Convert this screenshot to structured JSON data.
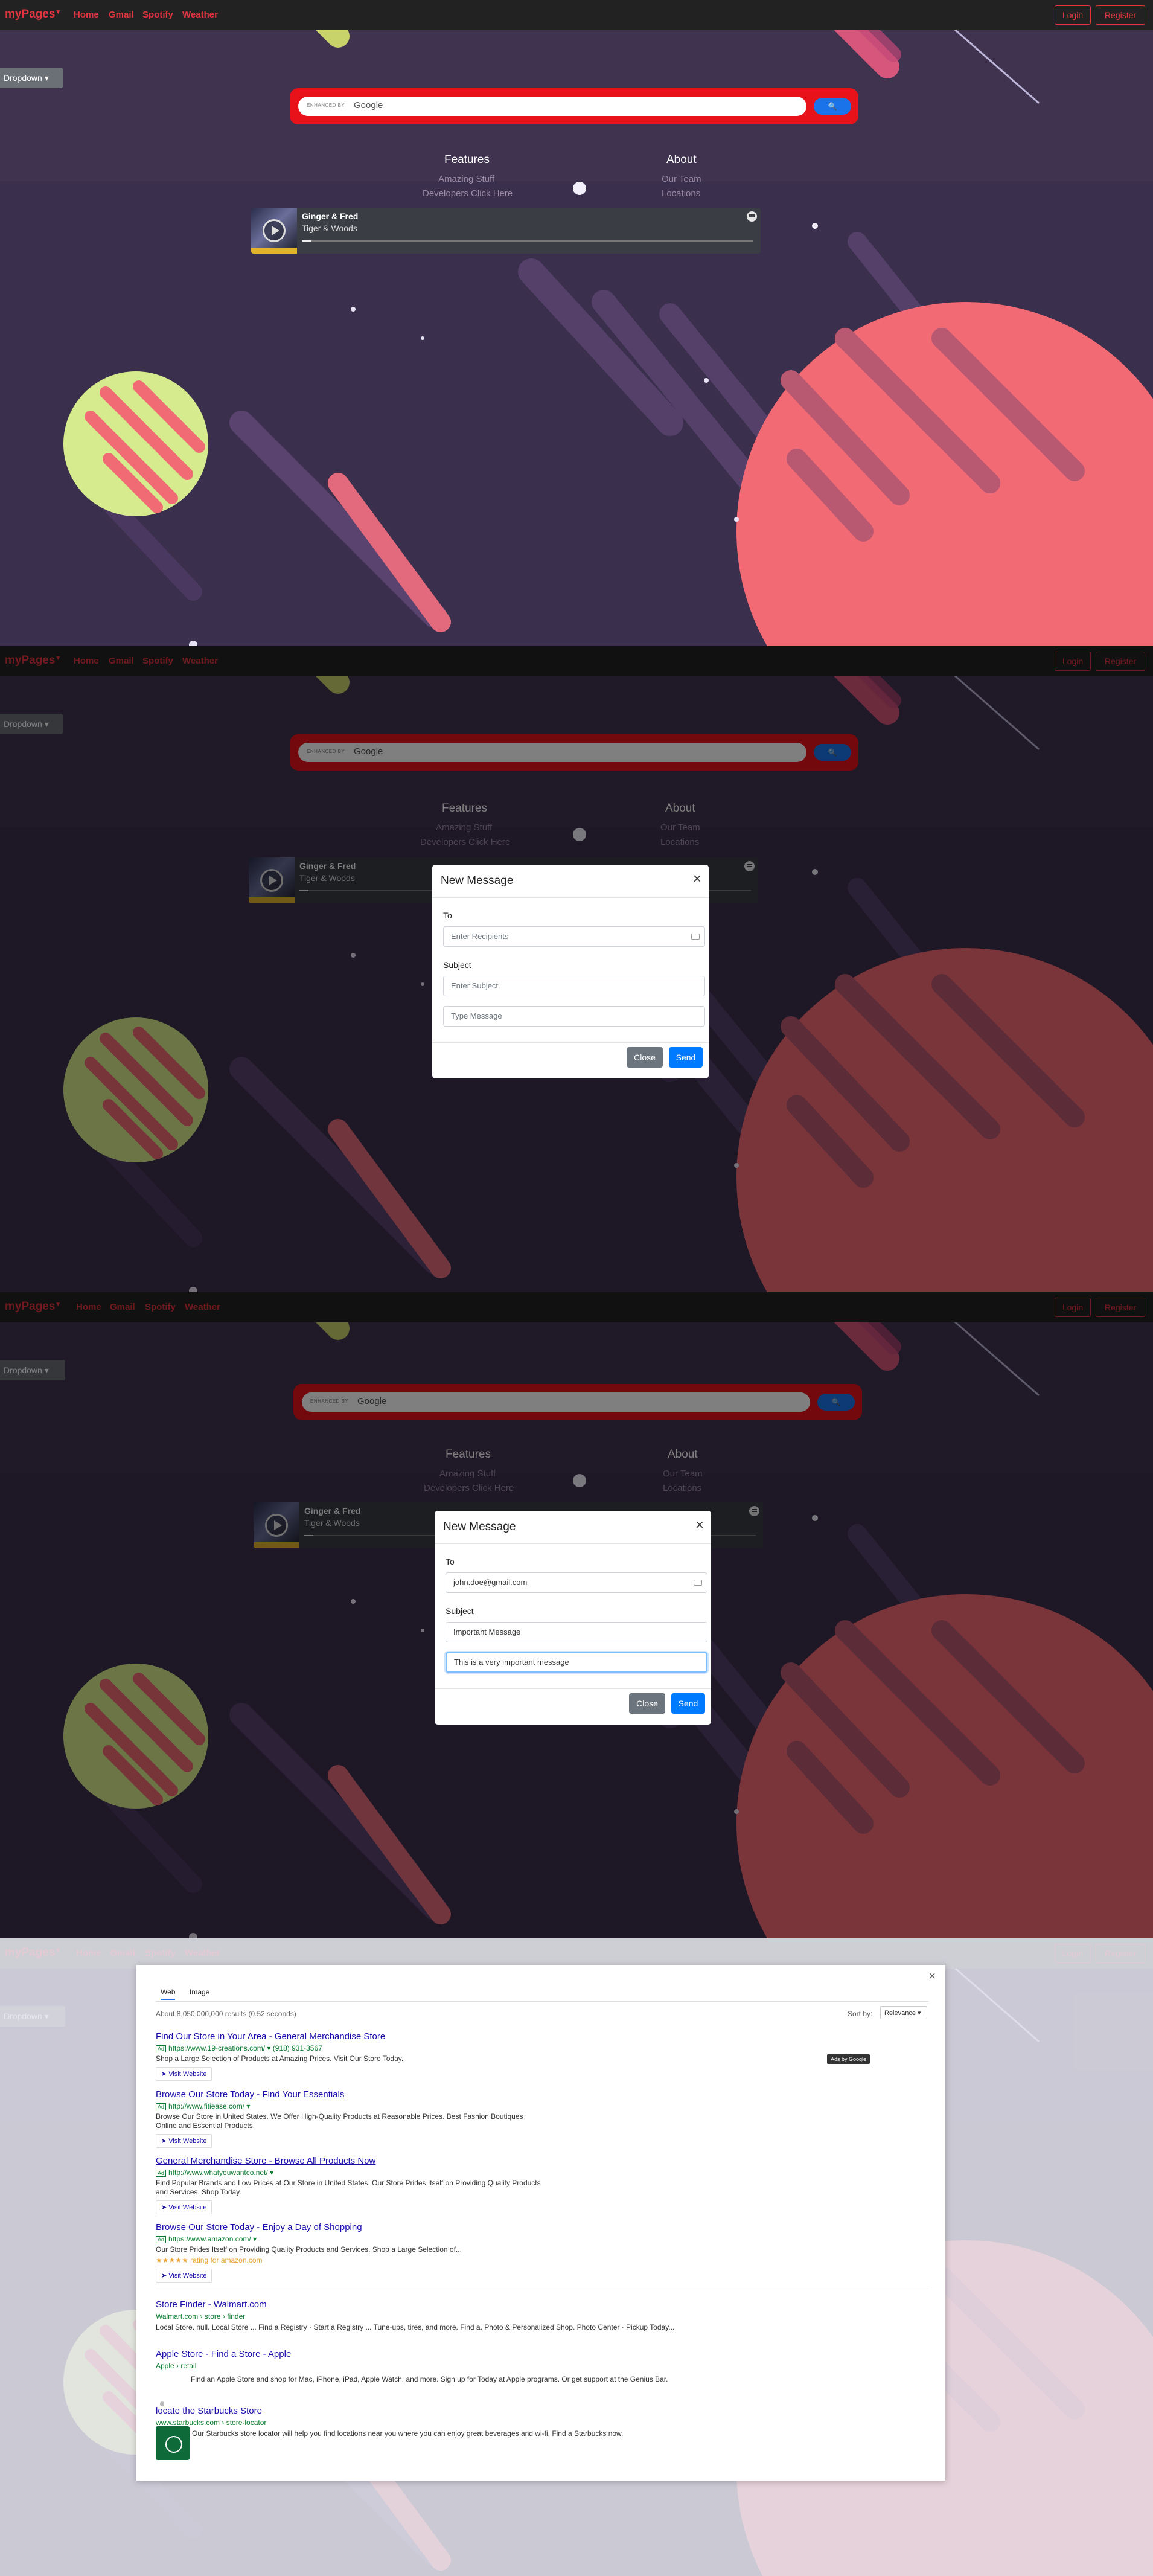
{
  "navbar": {
    "brand": "myPages",
    "brand_caret": "▾",
    "links": [
      "Home",
      "Gmail",
      "Spotify",
      "Weather"
    ],
    "login": "Login",
    "register": "Register"
  },
  "dropdown": {
    "label": "Dropdown ▾"
  },
  "search": {
    "enhanced_by": "ENHANCED BY",
    "google": "Google",
    "button_icon": "search-icon"
  },
  "features": {
    "title": "Features",
    "links": [
      "Amazing Stuff",
      "Developers Click Here"
    ]
  },
  "about": {
    "title": "About",
    "links": [
      "Our Team",
      "Locations"
    ]
  },
  "player": {
    "track": "Ginger & Fred",
    "artist": "Tiger & Woods",
    "progress": 0.02,
    "icon": "spotify-icon"
  },
  "modal": {
    "title": "New Message",
    "close_x": "×",
    "to_label": "To",
    "to_placeholder": "Enter Recipients",
    "subject_label": "Subject",
    "subject_placeholder": "Enter Subject",
    "message_placeholder": "Type Message",
    "close_button": "Close",
    "send_button": "Send",
    "filled": {
      "to": "john.doe@gmail.com",
      "subject": "Important Message",
      "message": "This is a very important message"
    }
  },
  "results": {
    "close_x": "×",
    "tabs": [
      "Web",
      "Image"
    ],
    "count": "About 8,050,000,000 results (0.52 seconds)",
    "sort_label": "Sort by:",
    "sort_value": "Relevance ▾",
    "ads_by": "Ads by Google",
    "visit": "➤ Visit Website",
    "ads": [
      {
        "title": "Find Our Store in Your Area - General Merchandise Store",
        "url": "https://www.19-creations.com/ ▾   (918) 931-3567",
        "desc": "Shop a Large Selection of Products at Amazing Prices. Visit Our Store Today."
      },
      {
        "title": "Browse Our Store Today - Find Your Essentials",
        "url": "http://www.fitiease.com/ ▾",
        "desc": "Browse Our Store in United States. We Offer High-Quality Products at Reasonable Prices. Best Fashion Boutiques Online and Essential Products."
      },
      {
        "title": "General Merchandise Store - Browse All Products Now",
        "url": "http://www.whatyouwantco.net/ ▾",
        "desc": "Find Popular Brands and Low Prices at Our Store in United States. Our Store Prides Itself on Providing Quality Products and Services. Shop Today."
      },
      {
        "title": "Browse Our Store Today - Enjoy a Day of Shopping",
        "url": "https://www.amazon.com/ ▾",
        "desc": "Our Store Prides Itself on Providing Quality Products and Services. Shop a Large Selection of...",
        "rating": "★★★★★ rating for amazon.com"
      }
    ],
    "organic": [
      {
        "title": "Store Finder - Walmart.com",
        "url": "Walmart.com › store › finder",
        "desc": "Local Store. null. Local Store ... Find a Registry · Start a Registry ... Tune-ups, tires, and more. Find a. Photo & Personalized Shop. Photo Center · Pickup Today..."
      },
      {
        "title": "Apple Store - Find a Store - Apple",
        "url": "Apple › retail",
        "desc": "Find an Apple Store and shop for Mac, iPhone, iPad, Apple Watch, and more. Sign up for Today at Apple programs. Or get support at the Genius Bar."
      },
      {
        "title": "locate the Starbucks Store",
        "url": "www.starbucks.com › store-locator",
        "desc": "Our Starbucks store locator will help you find locations near you where you can enjoy great beverages and wi-fi. Find a Starbucks now."
      }
    ]
  }
}
